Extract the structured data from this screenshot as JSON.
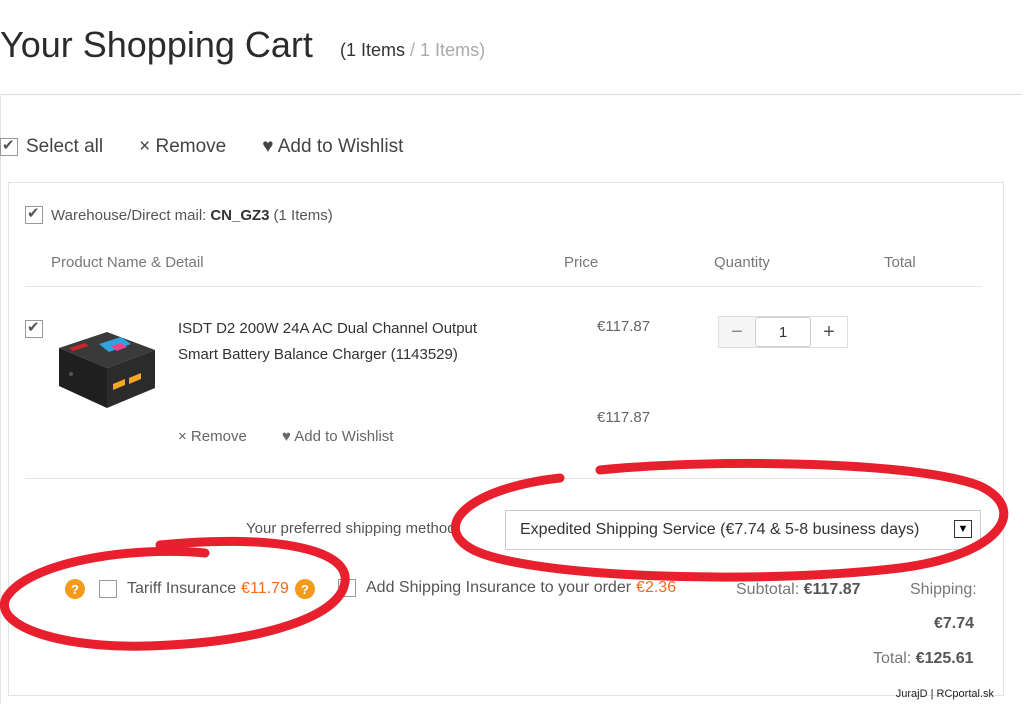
{
  "header": {
    "title": "Your Shopping Cart",
    "count_open": "(",
    "count_selected": "1 Items",
    "count_sep": " / ",
    "count_total": "1 Items)"
  },
  "actions": {
    "select_all": "Select all",
    "remove": "× Remove",
    "wishlist": "♥ Add to Wishlist"
  },
  "warehouse": {
    "label": "Warehouse/Direct mail:",
    "code": "CN_GZ3",
    "count": "(1 Items)"
  },
  "table": {
    "headers": [
      "Product Name & Detail",
      "Price",
      "Quantity",
      "Total"
    ]
  },
  "item": {
    "name": "ISDT D2 200W 24A AC Dual Channel Output Smart Battery Balance Charger (1143529)",
    "price": "€117.87",
    "total": "€117.87",
    "quantity": "1",
    "qty_minus": "−",
    "qty_plus": "+",
    "remove": "× Remove",
    "wishlist": "♥ Add to Wishlist"
  },
  "shipping": {
    "label": "Your preferred shipping method:",
    "selected": "Expedited Shipping Service (€7.74 & 5-8 business days)"
  },
  "insurance": {
    "help": "?",
    "tariff_label": "Tariff Insurance",
    "tariff_price": "€11.79",
    "shipping_label": "Add Shipping Insurance to your order",
    "shipping_price": "€2.36"
  },
  "summary": {
    "subtotal_label": "Subtotal:",
    "subtotal": "€117.87",
    "shipping_label": "Shipping:",
    "shipping": "€7.74",
    "total_label": "Total:",
    "total": "€125.61"
  },
  "watermark": "JurajD | RCportal.sk",
  "colors": {
    "accent": "#f26b1d",
    "help_icon": "#f59b1c",
    "annotation": "#e8202e"
  }
}
